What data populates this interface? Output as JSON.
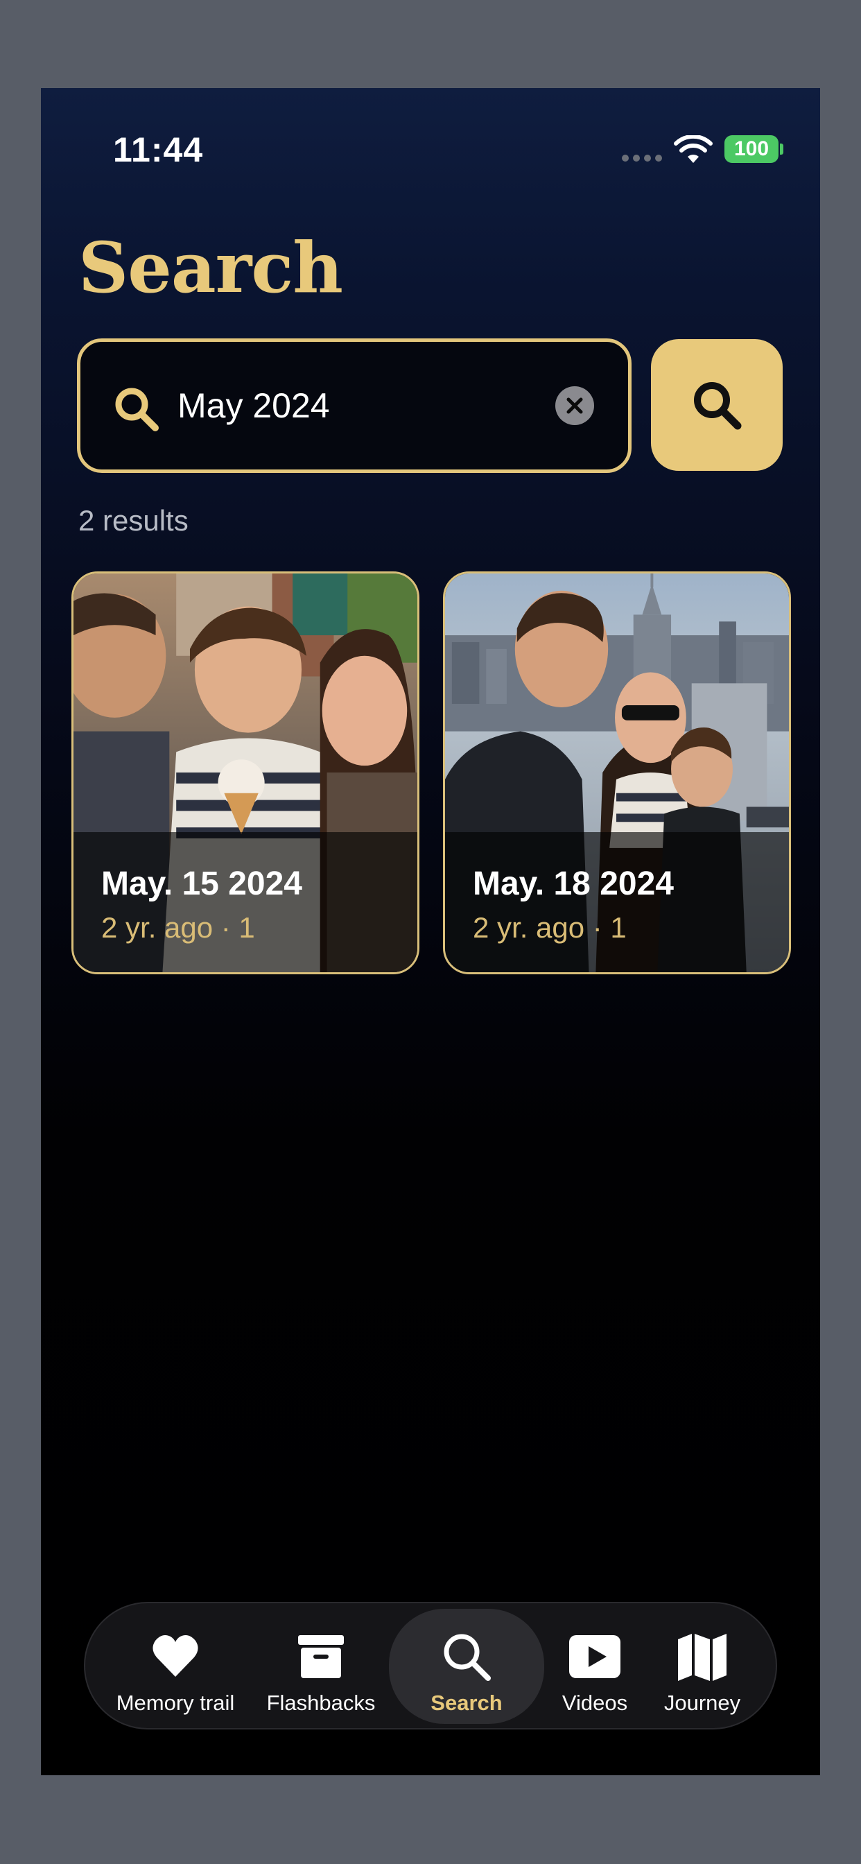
{
  "status_bar": {
    "time": "11:44",
    "battery": "100",
    "battery_color": "#4cc964"
  },
  "page": {
    "title": "Search",
    "accent_color": "#e8c97b"
  },
  "search": {
    "value": "May 2024",
    "icon": "search-icon",
    "clear_icon": "clear-x-icon"
  },
  "results": {
    "count_text": "2 results",
    "cards": [
      {
        "date": "May. 15 2024",
        "meta": "2 yr. ago · 1",
        "photo": "family-ice-cream-street-photo"
      },
      {
        "date": "May. 18 2024",
        "meta": "2 yr. ago · 1",
        "photo": "family-city-skyline-photo"
      }
    ]
  },
  "tabbar": {
    "active": "Search",
    "tabs": [
      {
        "label": "Memory trail",
        "icon": "heart-icon"
      },
      {
        "label": "Flashbacks",
        "icon": "archive-box-icon"
      },
      {
        "label": "Search",
        "icon": "search-icon"
      },
      {
        "label": "Videos",
        "icon": "play-icon"
      },
      {
        "label": "Journey",
        "icon": "map-icon"
      }
    ]
  }
}
